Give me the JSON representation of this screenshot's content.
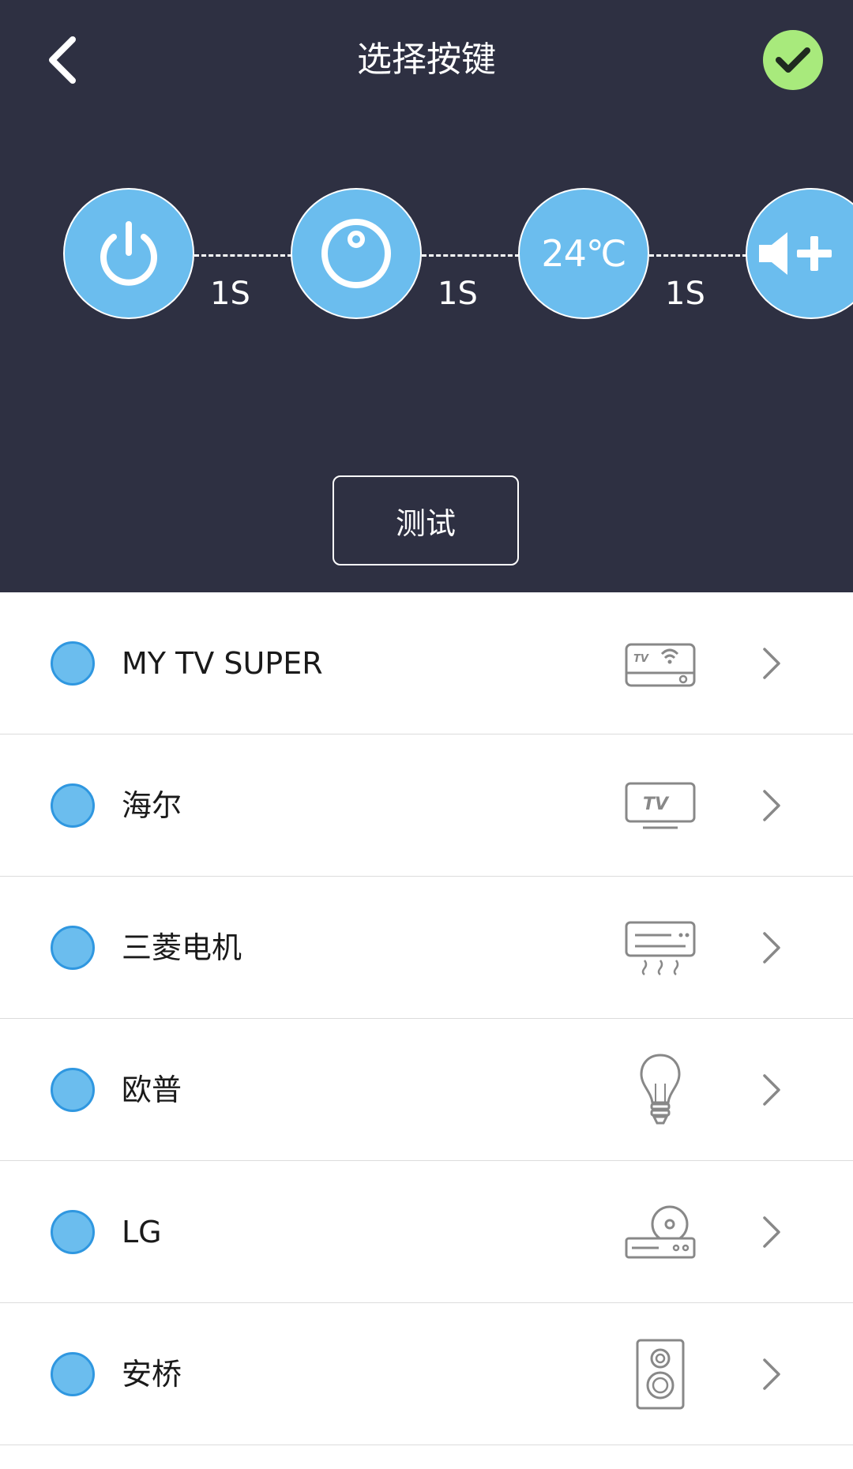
{
  "header": {
    "title": "选择按键",
    "back_icon": "chevron-left-icon",
    "confirm_icon": "check-icon",
    "confirm_color": "#a8ea7c",
    "background": "#2e3042"
  },
  "sequence": {
    "keys": [
      {
        "icon": "power-icon"
      },
      {
        "icon": "mode-icon"
      },
      {
        "text": "24℃"
      },
      {
        "icon": "volume-up-icon"
      }
    ],
    "delays": [
      "1S",
      "1S",
      "1S"
    ],
    "key_color": "#6bbdee"
  },
  "test_button": {
    "label": "测试"
  },
  "devices": [
    {
      "label": "MY TV SUPER",
      "icon": "tv-box-icon"
    },
    {
      "label": "海尔",
      "icon": "tv-icon"
    },
    {
      "label": "三菱电机",
      "icon": "air-conditioner-icon"
    },
    {
      "label": "欧普",
      "icon": "light-bulb-icon"
    },
    {
      "label": "LG",
      "icon": "dvd-player-icon"
    },
    {
      "label": "安桥",
      "icon": "speaker-icon"
    }
  ]
}
